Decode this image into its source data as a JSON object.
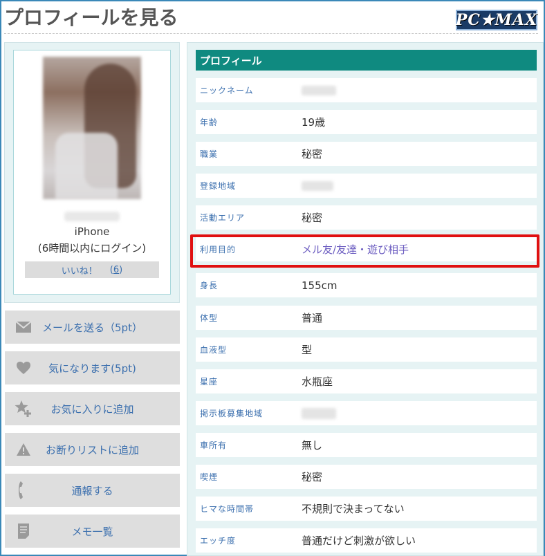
{
  "page": {
    "title": "プロフィールを見る",
    "logo": "PC★MAX"
  },
  "profile_card": {
    "device": "iPhone",
    "last_login": "(6時間以内にログイン)",
    "like_label": "いいね！",
    "like_count_open": "(",
    "like_count": "6",
    "like_count_close": ")"
  },
  "actions": [
    {
      "label": "メールを送る（5pt）",
      "icon": "mail-icon"
    },
    {
      "label": "気になります(5pt)",
      "icon": "heart-icon"
    },
    {
      "label": "お気に入りに追加",
      "icon": "star-add-icon"
    },
    {
      "label": "お断りリストに追加",
      "icon": "warning-icon"
    },
    {
      "label": "通報する",
      "icon": "phone-icon"
    },
    {
      "label": "メモ一覧",
      "icon": "memo-icon"
    }
  ],
  "profile": {
    "header": "プロフィール",
    "rows": [
      {
        "key": "ニックネーム",
        "value": ""
      },
      {
        "key": "年齢",
        "value": "19歳"
      },
      {
        "key": "職業",
        "value": "秘密"
      },
      {
        "key": "登録地域",
        "value": ""
      },
      {
        "key": "活動エリア",
        "value": "秘密"
      },
      {
        "key": "利用目的",
        "value": "メル友/友達・遊び相手"
      },
      {
        "key": "身長",
        "value": "155cm"
      },
      {
        "key": "体型",
        "value": "普通"
      },
      {
        "key": "血液型",
        "value": "型"
      },
      {
        "key": "星座",
        "value": "水瓶座"
      },
      {
        "key": "掲示板募集地域",
        "value": ""
      },
      {
        "key": "車所有",
        "value": "無し"
      },
      {
        "key": "喫煙",
        "value": "秘密"
      },
      {
        "key": "ヒマな時間帯",
        "value": "不規則で決まってない"
      },
      {
        "key": "エッチ度",
        "value": "普通だけど刺激が欲しい"
      }
    ]
  },
  "colors": {
    "frame": "#3a88b8",
    "header_bg": "#0f8a80",
    "link": "#3b6fae",
    "purpose_link": "#6b5cc0",
    "highlight": "#e01010"
  }
}
